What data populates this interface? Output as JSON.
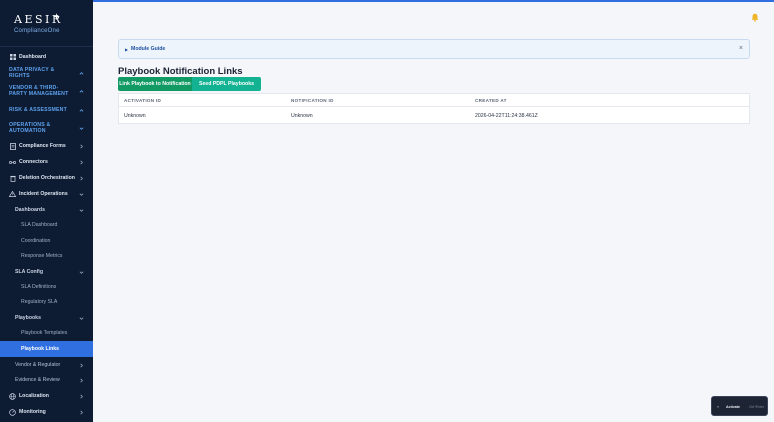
{
  "brand": {
    "name": "AESIR",
    "product": "ComplianceOne"
  },
  "sidebar": {
    "dashboard": "Dashboard",
    "sections": {
      "data_privacy": "DATA PRIVACY & RIGHTS",
      "vendor": "VENDOR & THIRD-PARTY MANAGEMENT",
      "risk": "RISK & ASSESSMENT",
      "operations": "OPERATIONS & AUTOMATION"
    },
    "compliance_forms": "Compliance Forms",
    "connectors": "Connectors",
    "deletion_orchestration": "Deletion Orchestration",
    "incident_operations": "Incident Operations",
    "dashboards": "Dashboards",
    "sla_dashboard": "SLA Dashboard",
    "coordination": "Coordination",
    "response_metrics": "Response Metrics",
    "sla_config": "SLA Config",
    "sla_definitions": "SLA Definitions",
    "regulatory_sla": "Regulatory SLA",
    "playbooks": "Playbooks",
    "playbook_templates": "Playbook Templates",
    "playbook_links": "Playbook Links",
    "vendor_regulator": "Vendor & Regulator",
    "evidence_review": "Evidence & Review",
    "localization": "Localization",
    "monitoring": "Monitoring"
  },
  "banner": {
    "label": "Module Guide",
    "close": "×"
  },
  "page": {
    "title": "Playbook Notification Links"
  },
  "actions": {
    "link_label": "Link Playbook to Notification",
    "seed_label": "Seed PDPL Playbooks"
  },
  "table": {
    "columns": [
      "ACTIVATION ID",
      "NOTIFICATION ID",
      "CREATED AT"
    ],
    "rows": [
      [
        "Unknown",
        "Unknown",
        "2026-04-22T11:24:38.461Z"
      ]
    ]
  },
  "toast": {
    "icon": "«",
    "label": "Activate",
    "hint": "Ctrl+Enter"
  },
  "colors": {
    "accent": "#2f6fe0",
    "primary_button": "#119a63",
    "secondary_button": "#13b293",
    "sidebar_bg": "#0d1b33"
  }
}
